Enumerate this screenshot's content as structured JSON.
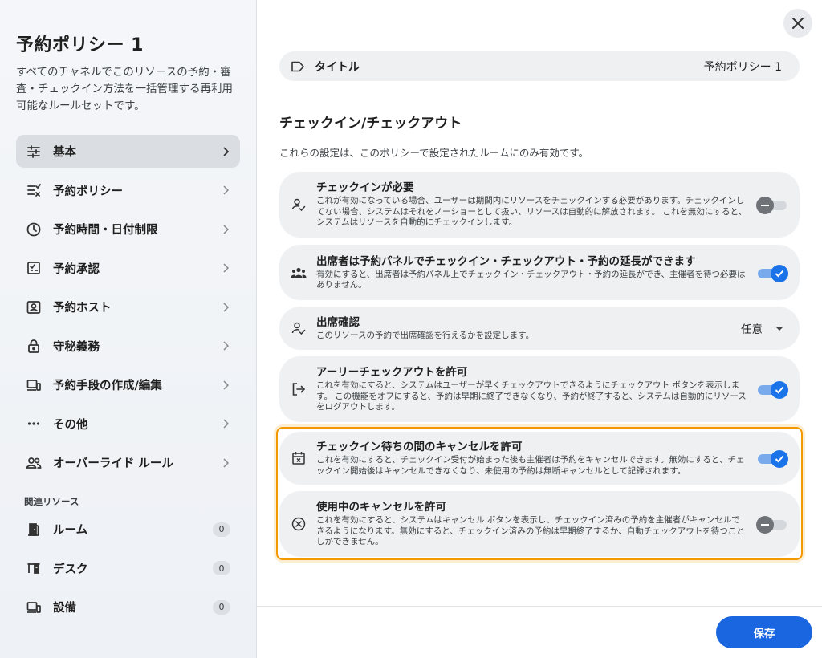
{
  "sidebar": {
    "title": "予約ポリシー 1",
    "description": "すべてのチャネルでこのリソースの予約・審査・チェックイン方法を一括管理する再利用可能なルールセットです。",
    "items": [
      {
        "label": "基本",
        "icon": "sliders-icon"
      },
      {
        "label": "予約ポリシー",
        "icon": "list-check-icon"
      },
      {
        "label": "予約時間・日付制限",
        "icon": "clock-icon"
      },
      {
        "label": "予約承認",
        "icon": "approval-icon"
      },
      {
        "label": "予約ホスト",
        "icon": "host-icon"
      },
      {
        "label": "守秘義務",
        "icon": "lock-icon"
      },
      {
        "label": "予約手段の作成/編集",
        "icon": "devices-icon"
      },
      {
        "label": "その他",
        "icon": "more-icon"
      },
      {
        "label": "オーバーライド ルール",
        "icon": "people-icon"
      }
    ],
    "resources_label": "関連リソース",
    "resources": [
      {
        "label": "ルーム",
        "count": "0"
      },
      {
        "label": "デスク",
        "count": "0"
      },
      {
        "label": "設備",
        "count": "0"
      }
    ]
  },
  "main": {
    "title_field": {
      "label": "タイトル",
      "value": "予約ポリシー 1"
    },
    "section_heading": "チェックイン/チェックアウト",
    "section_sub": "これらの設定は、このポリシーで設定されたルームにのみ有効です。",
    "cards": [
      {
        "title": "チェックインが必要",
        "desc": "これが有効になっている場合、ユーザーは期間内にリソースをチェックインする必要があります。チェックインしてない場合、システムはそれをノーショーとして扱い、リソースは自動的に解放されます。 これを無効にすると、システムはリソースを自動的にチェックインします。",
        "toggle": "off"
      },
      {
        "title": "出席者は予約パネルでチェックイン・チェックアウト・予約の延長ができます",
        "desc": "有効にすると、出席者は予約パネル上でチェックイン・チェックアウト・予約の延長ができ、主催者を待つ必要はありません。",
        "toggle": "on"
      },
      {
        "title": "出席確認",
        "desc": "このリソースの予約で出席確認を行えるかを設定します。",
        "select_value": "任意"
      },
      {
        "title": "アーリーチェックアウトを許可",
        "desc": "これを有効にすると、システムはユーザーが早くチェックアウトできるようにチェックアウト ボタンを表示します。 この機能をオフにすると、予約は早期に終了できなくなり、予約が終了すると、システムは自動的にリソースをログアウトします。",
        "toggle": "on"
      },
      {
        "title": "チェックイン待ちの間のキャンセルを許可",
        "desc": "これを有効にすると、チェックイン受付が始まった後も主催者は予約をキャンセルできます。無効にすると、チェックイン開始後はキャンセルできなくなり、未使用の予約は無断キャンセルとして記録されます。",
        "toggle": "on"
      },
      {
        "title": "使用中のキャンセルを許可",
        "desc": "これを有効にすると、システムはキャンセル ボタンを表示し、チェックイン済みの予約を主催者がキャンセルできるようになります。無効にすると、チェックイン済みの予約は早期終了するか、自動チェックアウトを待つことしかできません。",
        "toggle": "off"
      }
    ],
    "save_label": "保存"
  },
  "colors": {
    "accent": "#1a73e8",
    "highlight": "#f29900",
    "card_bg": "#eef0f2"
  }
}
